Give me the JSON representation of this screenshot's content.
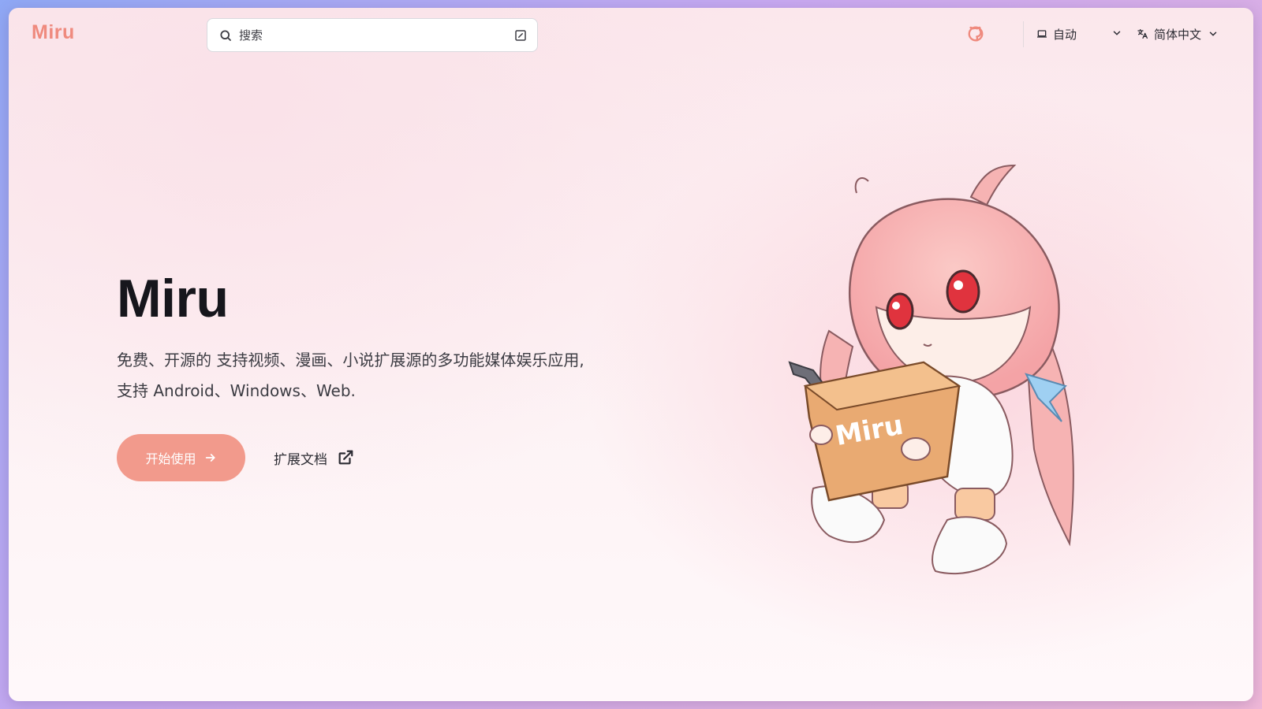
{
  "nav": {
    "logo": "Miru",
    "search_placeholder": "搜索",
    "appearance_label": "自动",
    "language_label": "简体中文"
  },
  "hero": {
    "title": "Miru",
    "description_line1": "免费、开源的 支持视频、漫画、小说扩展源的多功能媒体娱乐应用,",
    "description_line2": "支持 Android、Windows、Web.",
    "primary_button": "开始使用",
    "secondary_link": "扩展文档"
  },
  "mascot": {
    "box_text": "Miru"
  },
  "colors": {
    "brand": "#ef8a7e",
    "button": "#f29a8c",
    "text_dark": "#16161c",
    "text_body": "#3c3c43"
  }
}
